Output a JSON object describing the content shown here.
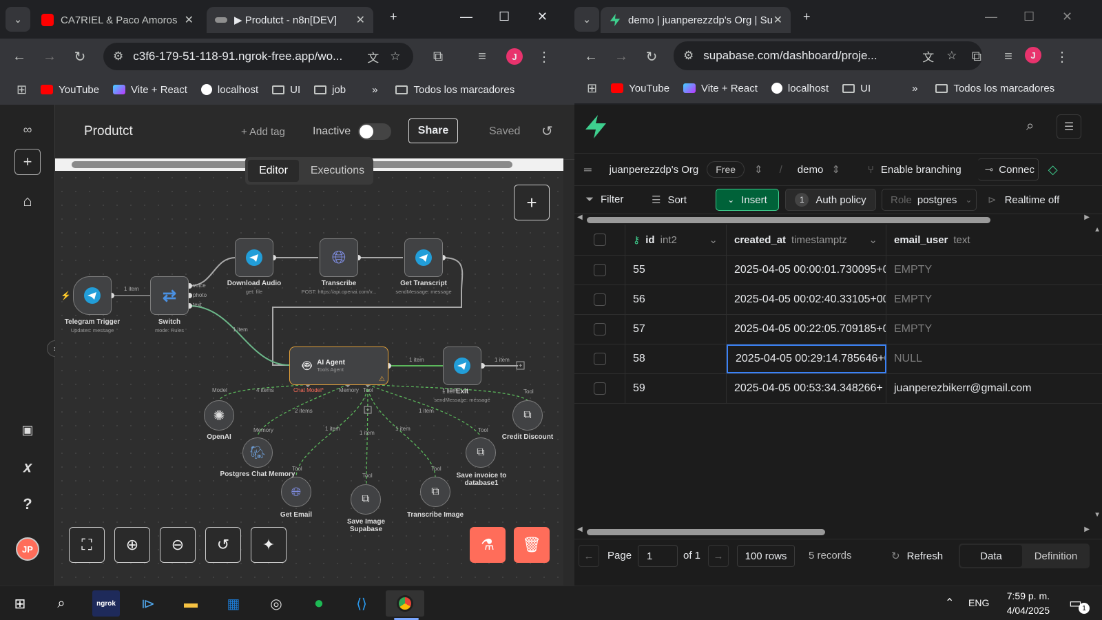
{
  "left_window": {
    "tabs": [
      {
        "title": "CA7RIEL & Paco Amoroso"
      },
      {
        "title": "▶ Produtct - n8n[DEV]"
      }
    ],
    "url": "c3f6-179-51-118-91.ngrok-free.app/wo...",
    "profile_initial": "J",
    "bookmarks": [
      "YouTube",
      "Vite + React",
      "localhost",
      "UI",
      "job"
    ],
    "all_bookmarks": "Todos los marcadores",
    "n8n": {
      "workflow_name": "Produtct",
      "add_tag": "+ Add tag",
      "active_label": "Inactive",
      "share_label": "Share",
      "saved_label": "Saved",
      "tabs": [
        "Editor",
        "Executions"
      ],
      "user_initials": "JP",
      "nodes": {
        "telegram_trigger": {
          "label": "Telegram Trigger",
          "sub": "Updates: message"
        },
        "switch": {
          "label": "Switch",
          "sub": "mode: Rules",
          "outputs": [
            "voice",
            "photo",
            "text"
          ]
        },
        "download_audio": {
          "label": "Download Audio",
          "sub": "get: file"
        },
        "transcribe": {
          "label": "Transcribe",
          "sub": "POST: https://api.openai.com/v..."
        },
        "get_transcript": {
          "label": "Get Transcript",
          "sub": "sendMessage: message"
        },
        "ai_agent": {
          "label": "AI Agent",
          "sub": "Tools Agent"
        },
        "exit": {
          "label": "Exit",
          "sub": "sendMessage: message"
        },
        "openai": {
          "label": "OpenAI"
        },
        "postgres": {
          "label": "Postgres Chat Memory"
        },
        "get_email": {
          "label": "Get Email"
        },
        "save_image": {
          "label": "Save Image Supabase"
        },
        "transcribe_image": {
          "label": "Transcribe Image"
        },
        "save_invoice": {
          "label": "Save invoice to database1"
        },
        "credit_discount": {
          "label": "Credit Discount"
        }
      },
      "connection_labels": {
        "trigger_switch": "1 item",
        "switch_agent": "1 item",
        "agent_exit": "1 item",
        "exit_out": "1 item",
        "model_items": "4 items",
        "memory_items": "2 items",
        "tool_email": "1 item",
        "tool_image": "1 item",
        "tool_transcribe": "1 item",
        "tool_invoice": "1 item",
        "tool_credit": "1 item",
        "exit_item": "1 item"
      },
      "port_labels": {
        "chat_model": "Chat Model*",
        "memory": "Memory",
        "tool": "Tool",
        "model": "Model"
      }
    }
  },
  "right_window": {
    "tab_title": "demo | juanperezzdp's Org | Su",
    "url": "supabase.com/dashboard/proje...",
    "profile_initial": "J",
    "bookmarks": [
      "YouTube",
      "Vite + React",
      "localhost",
      "UI"
    ],
    "all_bookmarks": "Todos los marcadores",
    "supabase": {
      "org": "juanperezzdp's Org",
      "plan": "Free",
      "project": "demo",
      "branching": "Enable branching",
      "connect": "Connec",
      "toolbar": {
        "filter": "Filter",
        "sort": "Sort",
        "insert": "Insert",
        "auth_count": "1",
        "auth_policy": "Auth policy",
        "role_label": "Role",
        "role_value": "postgres",
        "realtime": "Realtime off"
      },
      "columns": [
        {
          "name": "id",
          "type": "int2"
        },
        {
          "name": "created_at",
          "type": "timestamptz"
        },
        {
          "name": "email_user",
          "type": "text"
        }
      ],
      "rows": [
        {
          "id": "55",
          "created_at": "2025-04-05 00:00:01.730095+0",
          "email_user": "EMPTY"
        },
        {
          "id": "56",
          "created_at": "2025-04-05 00:02:40.33105+00",
          "email_user": "EMPTY"
        },
        {
          "id": "57",
          "created_at": "2025-04-05 00:22:05.709185+0",
          "email_user": "EMPTY"
        },
        {
          "id": "58",
          "created_at": "2025-04-05 00:29:14.785646+0",
          "email_user": "NULL"
        },
        {
          "id": "59",
          "created_at": "2025-04-05 00:53:34.348266+",
          "email_user": "juanperezbikerr@gmail.com"
        }
      ],
      "footer": {
        "page_label": "Page",
        "page_value": "1",
        "of_label": "of 1",
        "rows_per_page": "100 rows",
        "records": "5 records",
        "refresh": "Refresh",
        "view_data": "Data",
        "view_definition": "Definition"
      }
    }
  },
  "taskbar": {
    "language": "ENG",
    "time": "7:59 p. m.",
    "date": "4/04/2025",
    "notification_count": "1",
    "ngrok_label": "ngrok"
  },
  "colors": {
    "n8n_orange": "#ff6d5a",
    "supabase_green": "#3ecf8e",
    "insert_green": "#006239",
    "telegram_blue": "#229ed9",
    "success_green": "#5cb85c"
  }
}
